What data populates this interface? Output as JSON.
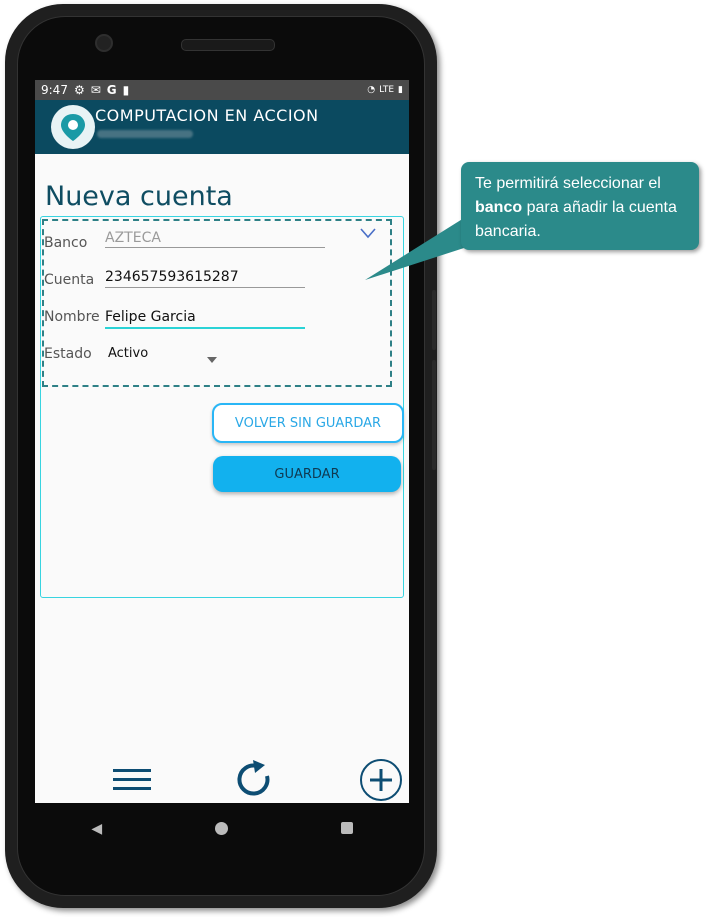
{
  "status_bar": {
    "time": "9:47",
    "network": "LTE"
  },
  "app": {
    "title": "COMPUTACION EN ACCION"
  },
  "page": {
    "title": "Nueva cuenta"
  },
  "form": {
    "bank_label": "Banco",
    "bank_value": "AZTECA",
    "account_label": "Cuenta",
    "account_value": "234657593615287",
    "name_label": "Nombre",
    "name_value": "Felipe Garcia",
    "status_label": "Estado",
    "status_value": "Activo"
  },
  "buttons": {
    "back": "VOLVER SIN GUARDAR",
    "save": "GUARDAR"
  },
  "tooltip": {
    "before": "Te permitirá seleccionar el ",
    "bold": "banco",
    "after": " para añadir la cuenta bancaria."
  },
  "colors": {
    "appbar": "#0b4a60",
    "accent": "#12b1ee",
    "tooltip": "#2b8a8a",
    "title": "#0f4d62"
  },
  "icons": {
    "menu": "menu-icon",
    "refresh": "refresh-icon",
    "add": "add-circle-icon"
  }
}
